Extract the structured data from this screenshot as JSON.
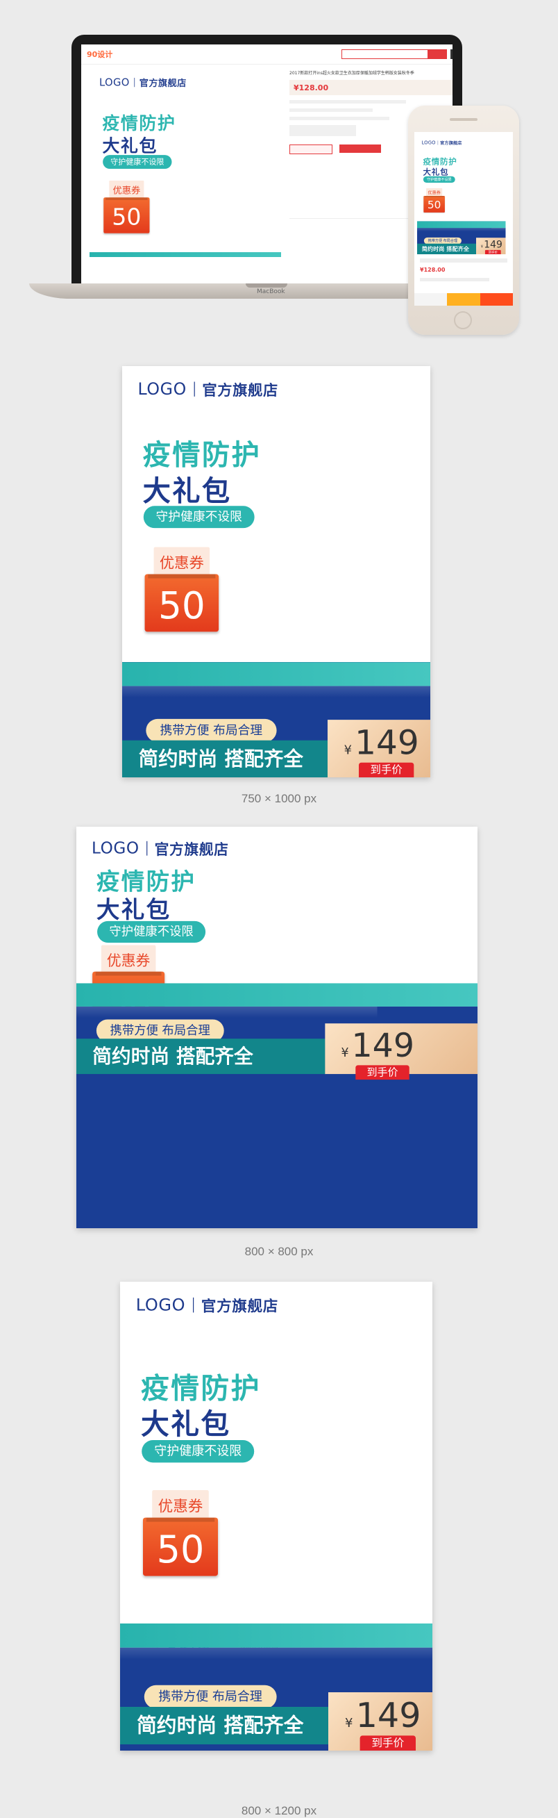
{
  "mockup": {
    "site_logo": "90设计",
    "laptop_brand": "MacBook",
    "product_title": "2017新款打开ins超火女款卫生衣加厚保暖加绒学生韩版女装秋冬季",
    "price": "¥128.00",
    "btn_buy": "立即购买",
    "btn_cart": "加入购物车"
  },
  "banner": {
    "logo": "LOGO",
    "store": "官方旗舰店",
    "title1": "疫情防护",
    "title2": "大礼包",
    "pill": "守护健康不设限",
    "coupon_label": "优惠券",
    "coupon_value": "50",
    "sub": "携带方便 布局合理",
    "slogan": "简约时尚 搭配齐全",
    "currency": "¥",
    "price": "149",
    "price_tag": "到手价"
  },
  "captions": {
    "c1": "750 × 1000 px",
    "c2": "800 × 800 px",
    "c3": "800 × 1200 px"
  }
}
